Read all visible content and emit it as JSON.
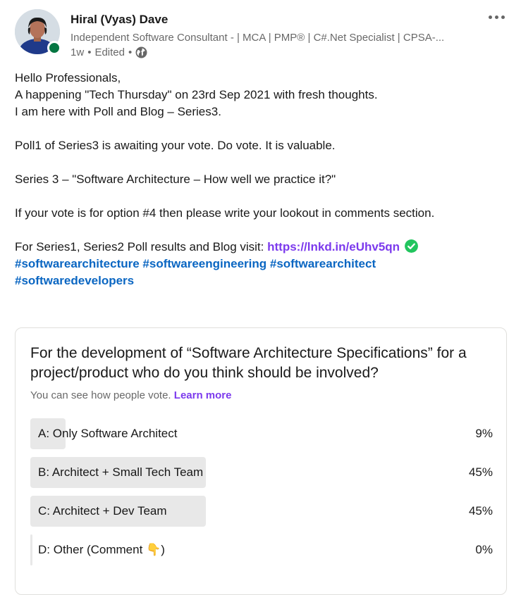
{
  "author": {
    "name": "Hiral (Vyas) Dave",
    "headline": "Independent Software Consultant - | MCA | PMP® | C#.Net Specialist | CPSA-...",
    "age": "1w",
    "separator": "•",
    "edited": "Edited",
    "presence_color": "#057642"
  },
  "commentary": {
    "line1": "Hello Professionals,",
    "line2": "A happening \"Tech Thursday\" on 23rd Sep 2021 with fresh thoughts.",
    "line3": "I am here with Poll and Blog – Series3.",
    "line4": "Poll1 of Series3 is awaiting your vote. Do vote. It is valuable.",
    "line5": "Series 3 – \"Software Architecture – How well we practice it?\"",
    "line6": "If your vote is for option #4 then please write your lookout in comments section.",
    "line7_prefix": "For Series1, Series2 Poll results and Blog visit: ",
    "link": "https://lnkd.in/eUhv5qn",
    "hashtags": [
      "#softwarearchitecture",
      "#softwareengineering",
      "#softwarearchitect",
      "#softwaredevelopers"
    ]
  },
  "poll": {
    "question": "For the development of “Software Architecture Specifications” for a project/product who do you think should be involved?",
    "note": "You can see how people vote.",
    "learn_more": "Learn more",
    "options": [
      {
        "label": "A: Only Software Architect",
        "percent": "9%",
        "value": 9
      },
      {
        "label": "B: Architect + Small Tech Team",
        "percent": "45%",
        "value": 45
      },
      {
        "label": "C: Architect + Dev Team",
        "percent": "45%",
        "value": 45
      },
      {
        "label": "D: Other (Comment 👇)",
        "percent": "0%",
        "value": 0
      }
    ]
  },
  "colors": {
    "link": "#7c3aed",
    "hashtag": "#0a66c2",
    "bar": "#e8e8e8",
    "check": "#22c55e"
  }
}
